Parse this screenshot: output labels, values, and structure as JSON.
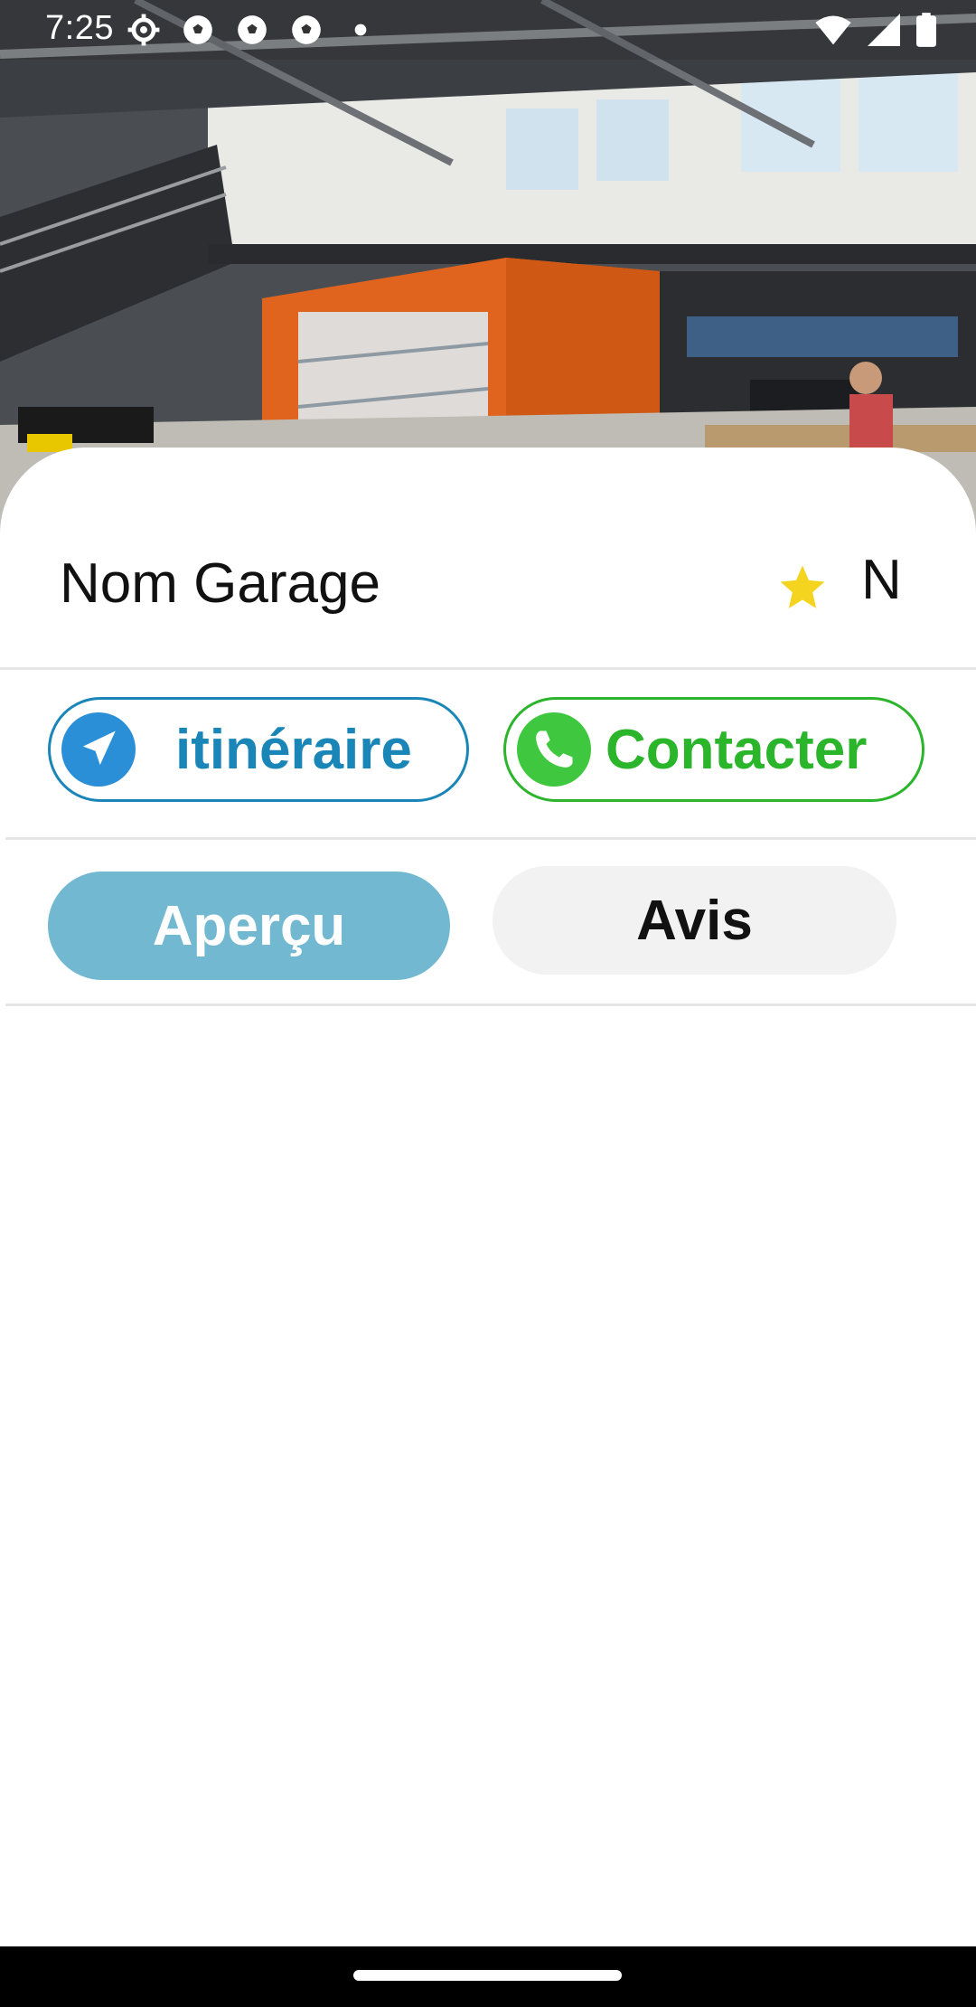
{
  "status_bar": {
    "time": "7:25",
    "icons": [
      "settings-icon",
      "soccer-ball-icon",
      "soccer-ball-icon",
      "soccer-ball-icon",
      "dot-icon"
    ],
    "right_icons": [
      "wifi-icon",
      "signal-icon",
      "battery-icon"
    ]
  },
  "hero": {
    "image": "garage-workshop-photo"
  },
  "garage": {
    "name": "Nom Garage",
    "rating": "N",
    "rating_icon": "star-icon"
  },
  "actions": {
    "route_label": "itinéraire",
    "route_icon": "navigation-arrow-icon",
    "contact_label": "Contacter",
    "contact_icon": "phone-icon"
  },
  "tabs": {
    "overview": "Aperçu",
    "reviews": "Avis",
    "active": "Aperçu"
  },
  "colors": {
    "route": "#1a86b8",
    "contact": "#2cb52c",
    "tab_active": "#72b8d0",
    "tab_inactive": "#f2f2f2",
    "star": "#f5d41f"
  }
}
